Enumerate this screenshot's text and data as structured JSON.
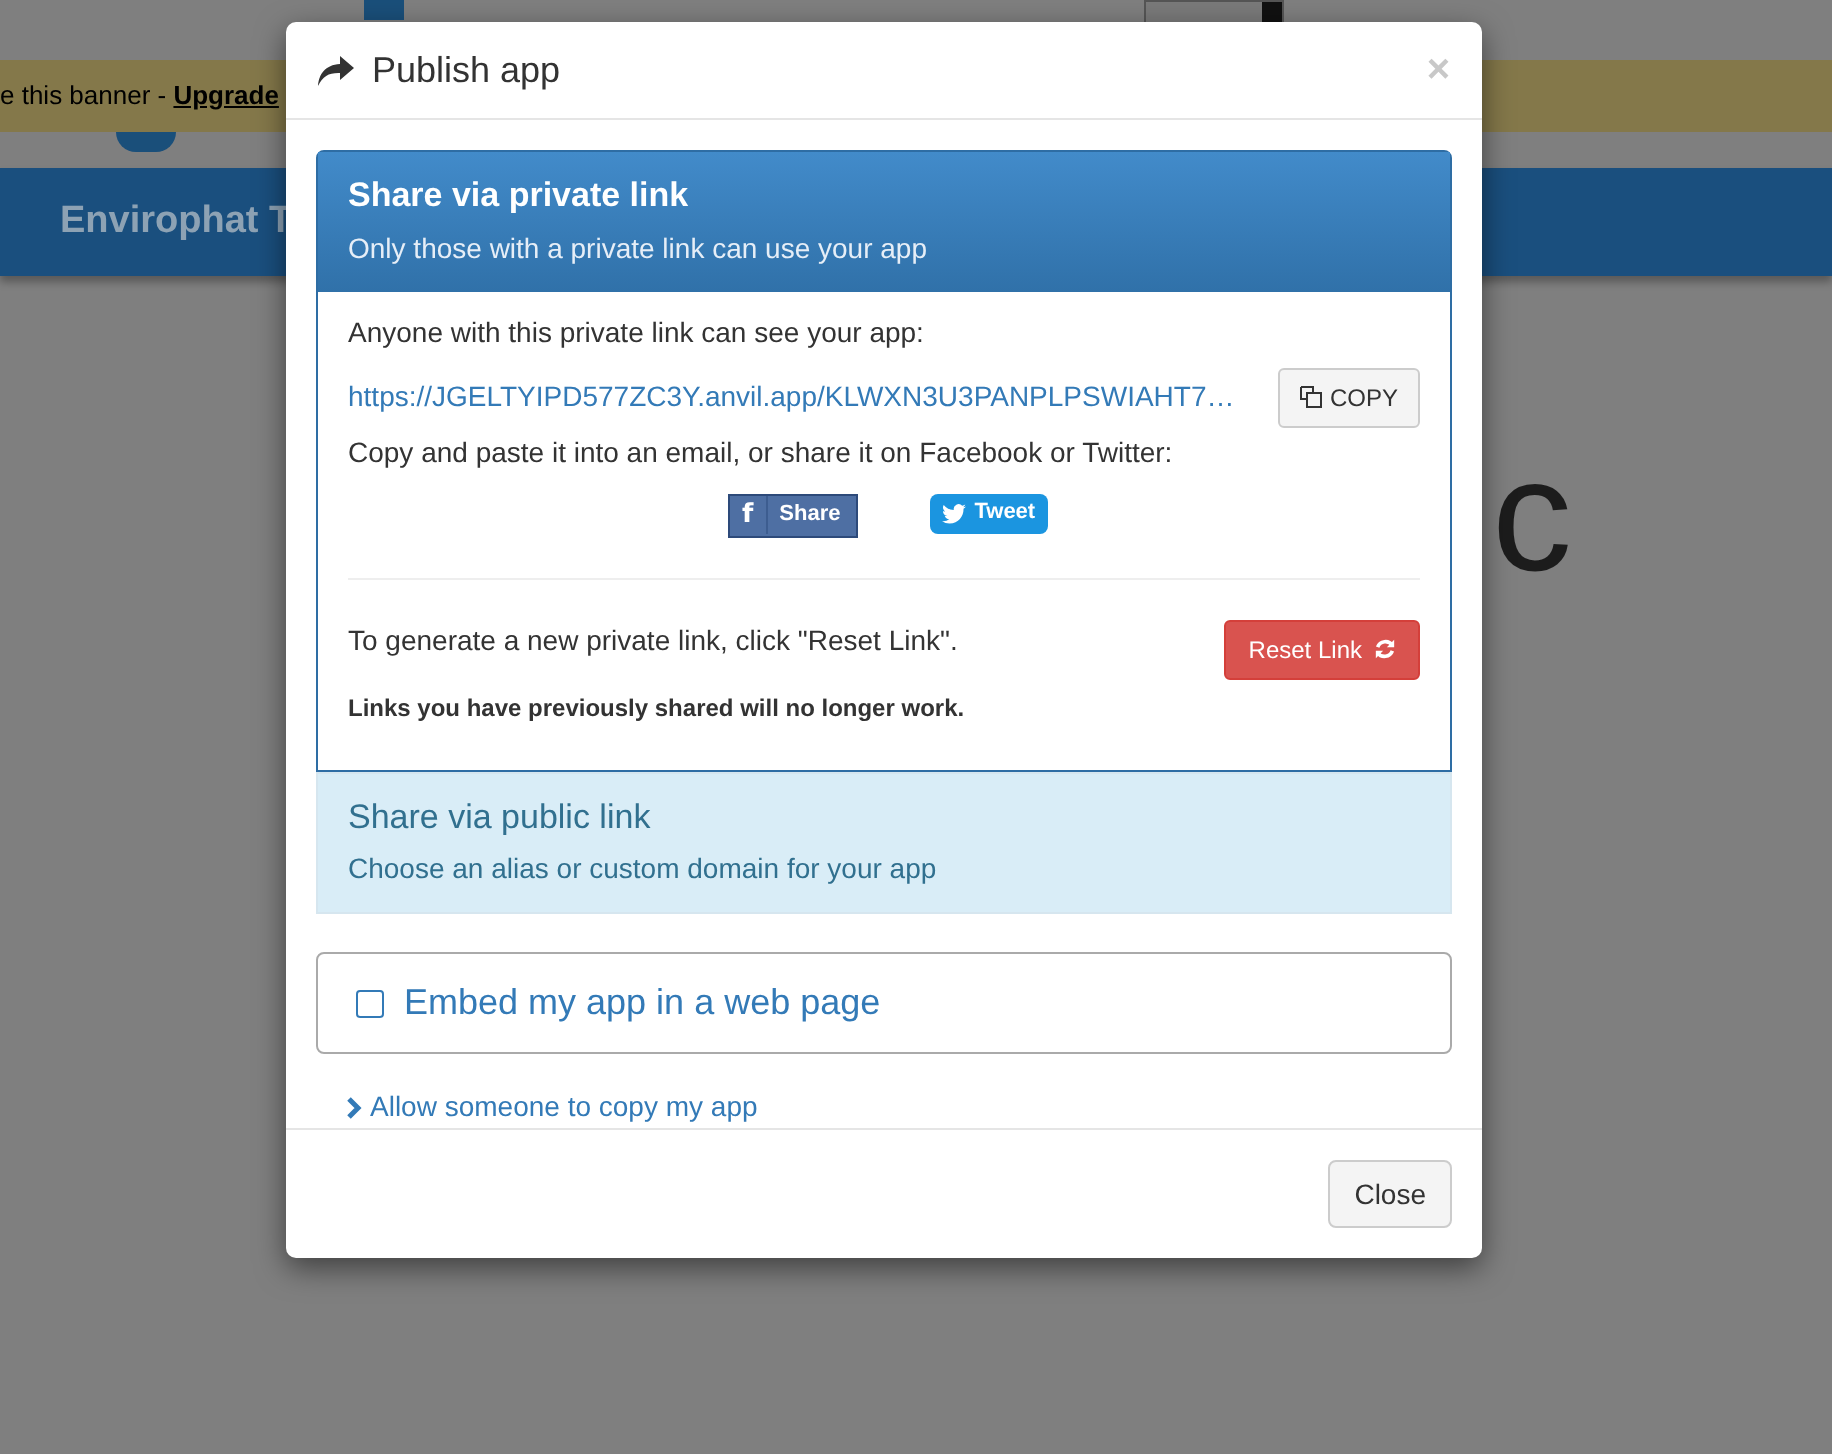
{
  "background": {
    "banner_text": "e this banner - ",
    "banner_link": "Upgrade",
    "header_title": "Envirophat T",
    "big_text": "c"
  },
  "dialog": {
    "title": "Publish app",
    "close": "×",
    "private_panel": {
      "title": "Share via private link",
      "subtitle": "Only those with a private link can use your app",
      "expanded": true,
      "intro": "Anyone with this private link can see your app:",
      "url": "https://JGELTYIPD577ZC3Y.anvil.app/KLWXN3U3PANPLPSWIAHT7…",
      "copy_button": "COPY",
      "share_text": "Copy and paste it into an email, or share it on Facebook or Twitter:",
      "social_buttons": [
        {
          "kind": "facebook",
          "icon": "f",
          "label": "Share"
        },
        {
          "kind": "twitter",
          "label": "Tweet"
        }
      ],
      "reset_text": "To generate a new private link, click \"Reset Link\".",
      "reset_button": "Reset Link",
      "warning": "Links you have previously shared will no longer work."
    },
    "public_panel": {
      "title": "Share via public link",
      "subtitle": "Choose an alias or custom domain for your app",
      "expanded": false
    },
    "embed": {
      "label": "Embed my app in a web page",
      "checked": false
    },
    "copy_link": "Allow someone to copy my app",
    "footer_button": "Close"
  }
}
